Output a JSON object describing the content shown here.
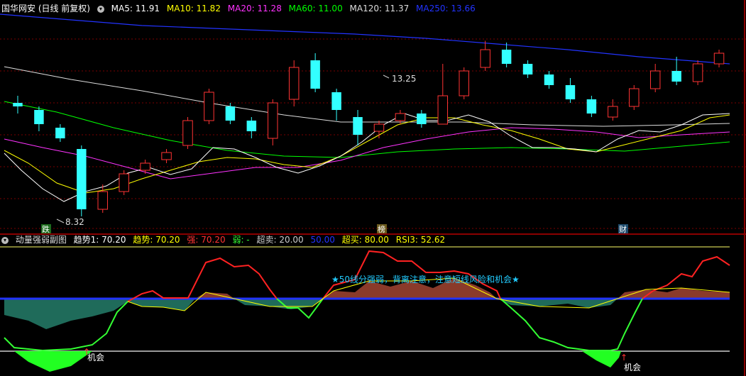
{
  "top_panel": {
    "title": "国华网安 (日线 前复权)",
    "ma": [
      {
        "label": "MA5: 11.91",
        "color": "#ffffff"
      },
      {
        "label": "MA10: 11.82",
        "color": "#ffff00"
      },
      {
        "label": "MA20: 11.28",
        "color": "#ff00ff"
      },
      {
        "label": "MA60: 11.00",
        "color": "#00ff00"
      },
      {
        "label": "MA120: 11.37",
        "color": "#dddddd"
      },
      {
        "label": "MA250: 13.66",
        "color": "#2233ff"
      }
    ],
    "price_high_label": "13.25",
    "price_low_label": "8.32",
    "event_markers": [
      "跌",
      "榜",
      "财"
    ]
  },
  "bottom_panel": {
    "title": "动量强弱副图",
    "items": [
      {
        "label": "趋势1: 70.20",
        "color": "#ffffff"
      },
      {
        "label": "趋势: 70.20",
        "color": "#ffff00"
      },
      {
        "label": "强: 70.20",
        "color": "#ff3333"
      },
      {
        "label": "弱: -",
        "color": "#33ff33"
      },
      {
        "label": "超卖: 20.00",
        "color": "#cccccc"
      },
      {
        "label": "50.00",
        "color": "#2233ff"
      },
      {
        "label": "超买: 80.00",
        "color": "#ffff00"
      },
      {
        "label": "RSI3: 52.62",
        "color": "#ffff00"
      }
    ],
    "annotation": "★50线分强弱，背离注意，注意短线风险和机会★",
    "signals": [
      "机会",
      "机会"
    ]
  },
  "chart_data": {
    "type": "candlestick",
    "series_count": 34,
    "candles": [
      {
        "o": 11.5,
        "c": 11.4,
        "h": 11.7,
        "l": 11.2
      },
      {
        "o": 11.3,
        "c": 10.9,
        "h": 11.4,
        "l": 10.7
      },
      {
        "o": 10.8,
        "c": 10.5,
        "h": 10.9,
        "l": 10.4
      },
      {
        "o": 10.2,
        "c": 8.5,
        "h": 10.3,
        "l": 8.3
      },
      {
        "o": 8.5,
        "c": 9.0,
        "h": 9.2,
        "l": 8.4
      },
      {
        "o": 9.0,
        "c": 9.5,
        "h": 9.6,
        "l": 8.9
      },
      {
        "o": 9.6,
        "c": 9.8,
        "h": 9.9,
        "l": 9.5
      },
      {
        "o": 9.9,
        "c": 10.1,
        "h": 10.2,
        "l": 9.8
      },
      {
        "o": 10.3,
        "c": 11.0,
        "h": 11.1,
        "l": 10.2
      },
      {
        "o": 11.0,
        "c": 11.8,
        "h": 11.9,
        "l": 10.9
      },
      {
        "o": 11.4,
        "c": 11.0,
        "h": 11.5,
        "l": 10.9
      },
      {
        "o": 11.0,
        "c": 10.7,
        "h": 11.1,
        "l": 10.5
      },
      {
        "o": 10.5,
        "c": 11.5,
        "h": 11.6,
        "l": 10.3
      },
      {
        "o": 11.6,
        "c": 12.5,
        "h": 12.7,
        "l": 11.4
      },
      {
        "o": 12.7,
        "c": 11.9,
        "h": 12.9,
        "l": 11.8
      },
      {
        "o": 11.8,
        "c": 11.3,
        "h": 11.9,
        "l": 11.0
      },
      {
        "o": 11.1,
        "c": 10.6,
        "h": 11.3,
        "l": 10.3
      },
      {
        "o": 10.7,
        "c": 10.9,
        "h": 11.0,
        "l": 10.5
      },
      {
        "o": 11.0,
        "c": 11.2,
        "h": 11.3,
        "l": 10.9
      },
      {
        "o": 11.2,
        "c": 10.9,
        "h": 11.3,
        "l": 10.8
      },
      {
        "o": 10.9,
        "c": 11.7,
        "h": 12.6,
        "l": 10.9
      },
      {
        "o": 11.7,
        "c": 12.4,
        "h": 12.5,
        "l": 11.6
      },
      {
        "o": 12.5,
        "c": 13.0,
        "h": 13.25,
        "l": 12.4
      },
      {
        "o": 13.0,
        "c": 12.6,
        "h": 13.2,
        "l": 12.5
      },
      {
        "o": 12.6,
        "c": 12.3,
        "h": 12.7,
        "l": 12.2
      },
      {
        "o": 12.3,
        "c": 12.0,
        "h": 12.4,
        "l": 11.9
      },
      {
        "o": 12.0,
        "c": 11.6,
        "h": 12.2,
        "l": 11.5
      },
      {
        "o": 11.6,
        "c": 11.2,
        "h": 11.7,
        "l": 11.1
      },
      {
        "o": 11.1,
        "c": 11.4,
        "h": 11.6,
        "l": 11.0
      },
      {
        "o": 11.4,
        "c": 11.9,
        "h": 12.0,
        "l": 11.3
      },
      {
        "o": 11.9,
        "c": 12.4,
        "h": 12.6,
        "l": 11.8
      },
      {
        "o": 12.4,
        "c": 12.1,
        "h": 12.8,
        "l": 12.0
      },
      {
        "o": 12.1,
        "c": 12.6,
        "h": 12.7,
        "l": 12.0
      },
      {
        "o": 12.6,
        "c": 12.9,
        "h": 13.0,
        "l": 12.5
      }
    ],
    "oscillator_levels": {
      "oversold": 20,
      "mid": 50,
      "overbought": 80,
      "rsi3": 52.62
    }
  }
}
